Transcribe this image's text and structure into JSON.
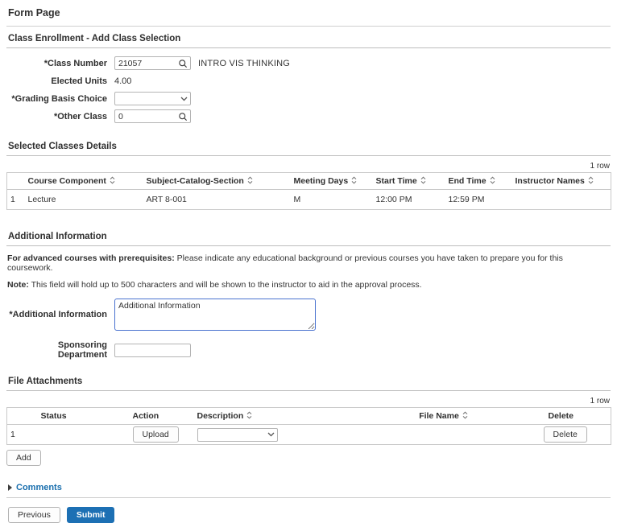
{
  "page": {
    "title": "Form Page"
  },
  "colors": {
    "primary_button_blue": "#1d70b4",
    "comments_link_blue": "#1a6fae",
    "textarea_focus_border_blue": "#4a72cf",
    "table_border_gray": "#c9c9c9"
  },
  "enrollment": {
    "section_title": "Class Enrollment - Add Class Selection",
    "class_number": {
      "label": "*Class Number",
      "value": "21057",
      "description": "INTRO VIS THINKING"
    },
    "elected_units": {
      "label": "Elected Units",
      "value": "4.00"
    },
    "grading_basis": {
      "label": "*Grading Basis Choice",
      "selected_value": ""
    },
    "other_class": {
      "label": "*Other Class",
      "value": "0"
    }
  },
  "selected_classes": {
    "section_title": "Selected Classes Details",
    "row_count": "1 row",
    "columns": {
      "course_component": "Course Component",
      "subject_catalog_section": "Subject-Catalog-Section",
      "meeting_days": "Meeting Days",
      "start_time": "Start Time",
      "end_time": "End Time",
      "instructor_names": "Instructor Names"
    },
    "rows": [
      {
        "num": "1",
        "course_component": "Lecture",
        "subject_catalog_section": "ART 8-001",
        "meeting_days": "M",
        "start_time": "12:00 PM",
        "end_time": "12:59 PM",
        "instructor_names": ""
      }
    ]
  },
  "additional_info": {
    "section_title": "Additional Information",
    "prereq_lead": "For advanced courses with prerequisites:",
    "prereq_text": " Please indicate any educational background or previous courses you have taken to prepare you for this coursework.",
    "note_lead": "Note:",
    "note_text": " This field will hold up to 500 characters and will be shown to the instructor to aid in the approval process.",
    "textarea_label": "*Additional Information",
    "textarea_value": "Additional Information",
    "sponsoring_department": {
      "label": "Sponsoring Department",
      "value": ""
    }
  },
  "file_attachments": {
    "section_title": "File Attachments",
    "row_count": "1 row",
    "columns": {
      "status": "Status",
      "action": "Action",
      "description": "Description",
      "file_name": "File Name",
      "delete": "Delete"
    },
    "rows": [
      {
        "num": "1",
        "status": "",
        "action_button": "Upload",
        "description_selected": "",
        "file_name": "",
        "delete_button": "Delete"
      }
    ],
    "add_button": "Add"
  },
  "comments": {
    "label": "Comments"
  },
  "footer": {
    "previous_button": "Previous",
    "submit_button": "Submit"
  }
}
